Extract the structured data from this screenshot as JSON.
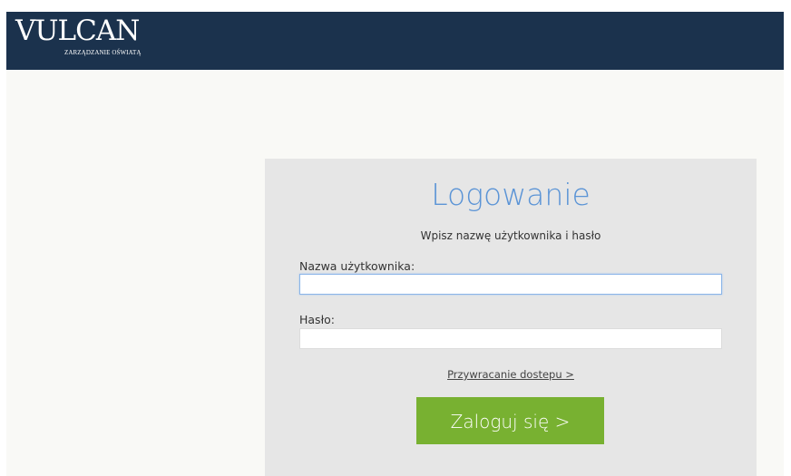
{
  "header": {
    "logo_text": "VULCAN",
    "logo_subtitle": "ZARZĄDZANIE OŚWIATĄ"
  },
  "login": {
    "title": "Logowanie",
    "subtitle": "Wpisz nazwę użytkownika i hasło",
    "username_label": "Nazwa użytkownika:",
    "username_value": "",
    "password_label": "Hasło:",
    "password_value": "",
    "recover_link": "Przywracanie dostepu >",
    "submit_label": "Zaloguj się >"
  },
  "colors": {
    "header_bg": "#1b324d",
    "title": "#5b94d6",
    "button_bg": "#78b131",
    "panel_bg": "#e6e6e6"
  }
}
